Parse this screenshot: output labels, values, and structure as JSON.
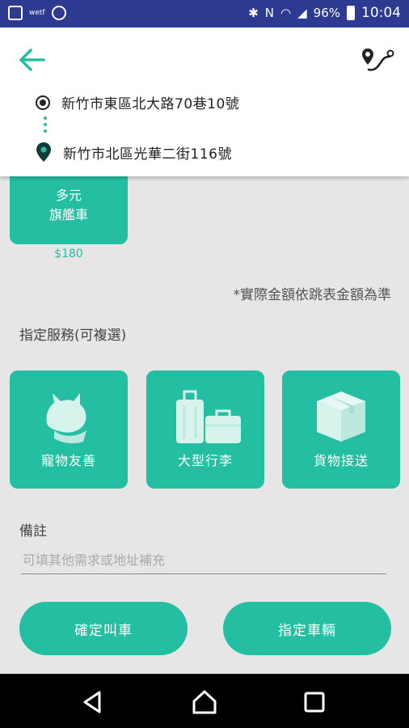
{
  "status_bar": {
    "carrier_tag": "wetf",
    "battery": "96%",
    "time": "10:04"
  },
  "header": {
    "origin_address": "新竹市東區北大路70巷10號",
    "destination_address": "新竹市北區光華二街116號"
  },
  "vehicle": {
    "name": "多元\n旗艦車",
    "price": "$180"
  },
  "fare_note": "*實際金額依跳表金額為準",
  "services": {
    "title": "指定服務(可複選)",
    "items": [
      {
        "label": "寵物友善",
        "icon": "pet-icon"
      },
      {
        "label": "大型行李",
        "icon": "luggage-icon"
      },
      {
        "label": "貨物接送",
        "icon": "package-icon"
      }
    ]
  },
  "remark": {
    "label": "備註",
    "placeholder": "可填其他需求或地址補充"
  },
  "actions": {
    "confirm_label": "確定叫車",
    "assign_label": "指定車輛"
  },
  "colors": {
    "accent": "#24bfa3",
    "status_bar": "#2c3a92",
    "background": "#e6e6e6"
  }
}
